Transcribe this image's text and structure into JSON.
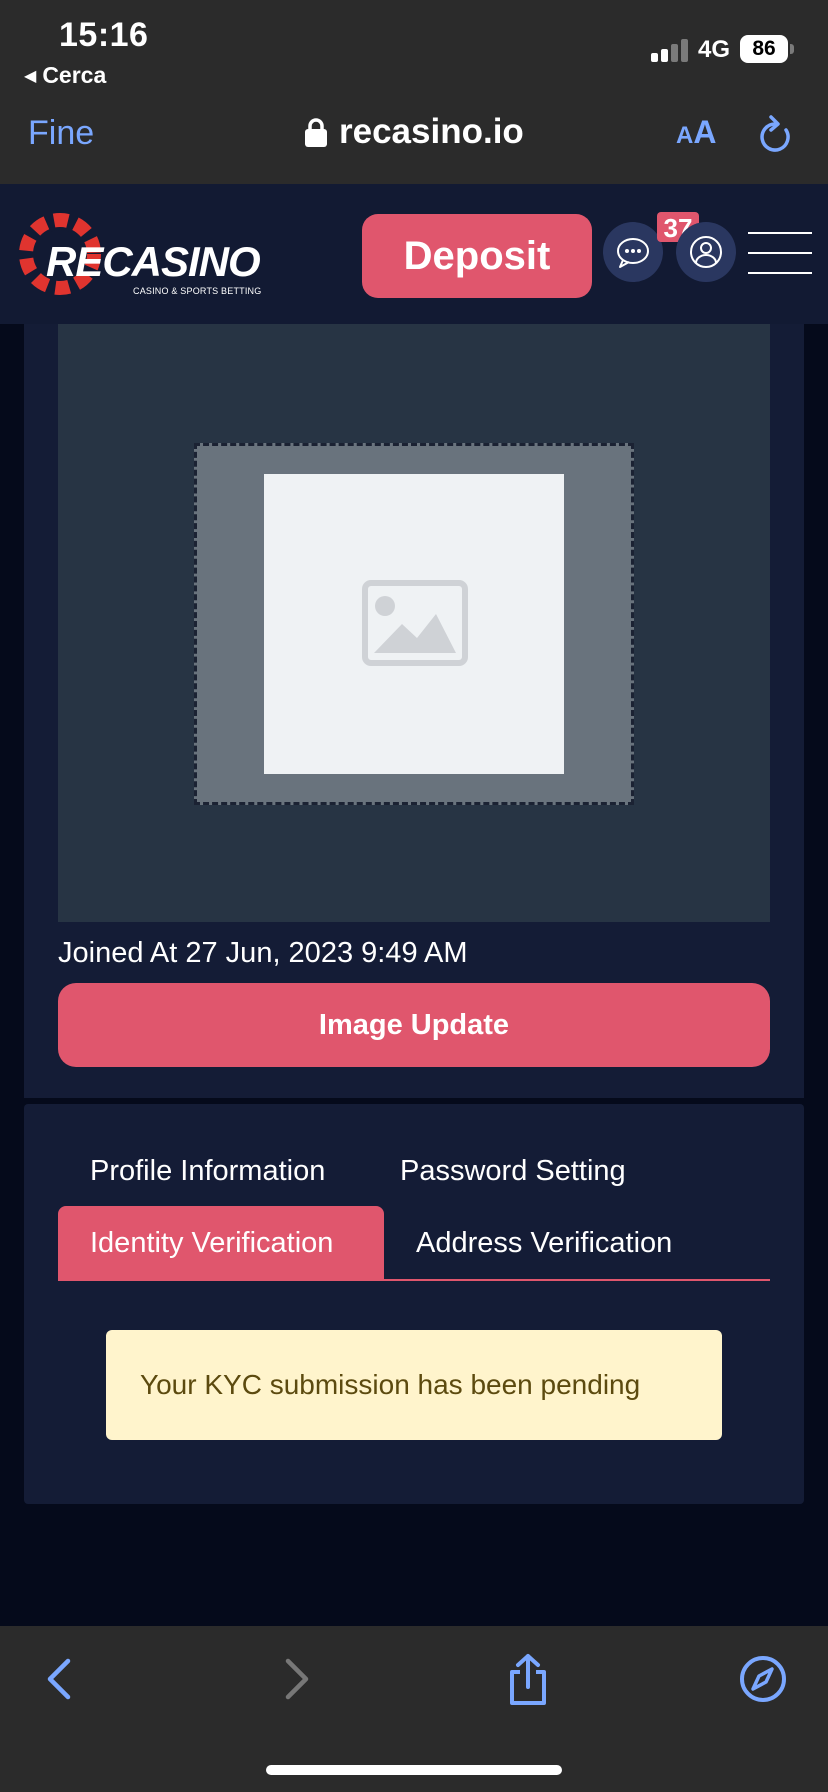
{
  "status_bar": {
    "time": "15:16",
    "back_label": "Cerca",
    "network": "4G",
    "battery": "86"
  },
  "browser": {
    "done_label": "Fine",
    "url": "recasino.io",
    "text_size_small": "A",
    "text_size_big": "A"
  },
  "header": {
    "logo_text": "RECASINO",
    "logo_subtitle": "CASINO & SPORTS BETTING",
    "deposit_label": "Deposit",
    "chat_badge_count": "37"
  },
  "profile": {
    "joined_text": "Joined At 27 Jun, 2023 9:49 AM",
    "image_update_label": "Image Update"
  },
  "tabs": [
    {
      "label": "Profile Information",
      "active": false
    },
    {
      "label": "Password Setting",
      "active": false
    },
    {
      "label": "Identity Verification",
      "active": true
    },
    {
      "label": "Address Verification",
      "active": false
    }
  ],
  "kyc": {
    "message": "Your KYC submission has been pending"
  },
  "colors": {
    "accent": "#e0566d",
    "header_bg": "#121a33",
    "page_bg": "#050a1b",
    "alert_bg": "#fff4cc",
    "browser_blue": "#7aa7ff"
  }
}
